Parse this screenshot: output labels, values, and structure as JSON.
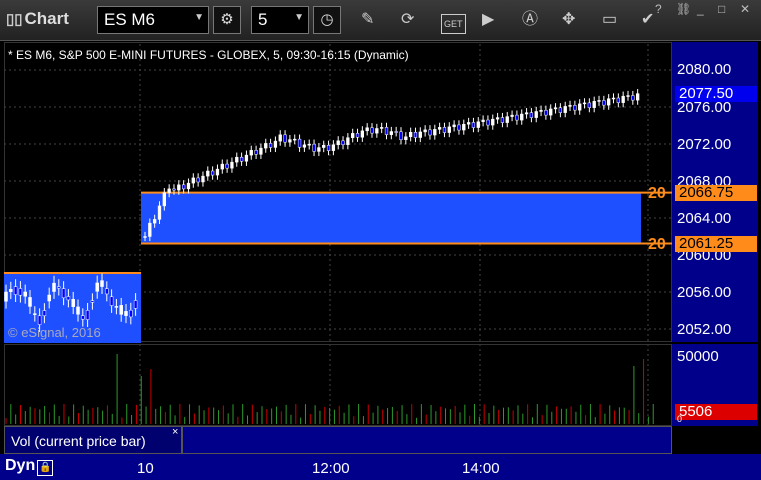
{
  "app": {
    "title": "Chart"
  },
  "toolbar": {
    "symbol": "ES M6",
    "interval": "5",
    "icons": [
      "gear-icon",
      "clock-icon",
      "pencil-icon",
      "refresh-icon",
      "get-icon",
      "play-icon",
      "alert-icon",
      "tools-icon",
      "comment-icon",
      "twitter-icon"
    ]
  },
  "chart": {
    "title": "* ES M6, S&P 500 E-MINI FUTURES - GLOBEX, 5, 09:30-16:15 (Dynamic)",
    "watermark": "© eSignal, 2016",
    "yaxis_labels": [
      "2080.00",
      "2076.00",
      "2072.00",
      "2068.00",
      "2064.00",
      "2060.00",
      "2056.00",
      "2052.00"
    ],
    "current_price": "2077.50",
    "level_high": "2066.75",
    "level_low": "2061.25",
    "level_tag_high": "20",
    "level_tag_low": "20"
  },
  "volume": {
    "label": "Vol (current price bar)",
    "close": "×",
    "axis_top": "50000",
    "current": "5506",
    "axis_zero": "0"
  },
  "xaxis": {
    "dyn": "Dyn",
    "labels": [
      "10",
      "12:00",
      "14:00"
    ]
  },
  "colors": {
    "accent_blue": "#1e50ff",
    "level_orange": "#ff8c1a",
    "current_price_tag": "#0000ee",
    "volume_tag": "#dd0000"
  },
  "chart_data": {
    "type": "candlestick",
    "price_range": [
      2050,
      2082
    ],
    "levels": [
      2066.75,
      2061.25
    ],
    "current_price": 2077.5,
    "volume_current": 5506
  }
}
